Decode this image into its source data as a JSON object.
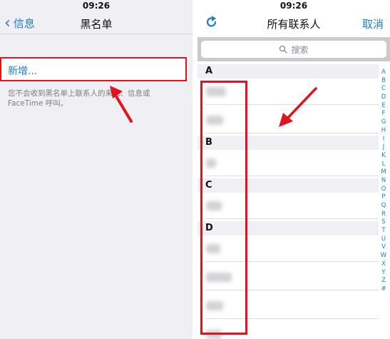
{
  "left": {
    "status_time": "09:26",
    "back_label": "信息",
    "title": "黑名单",
    "add_label": "新增...",
    "hint": "您不会收到黑名单上联系人的来电、信息或 FaceTime 呼叫。"
  },
  "right": {
    "status_time": "09:26",
    "title": "所有联系人",
    "cancel_label": "取消",
    "search_placeholder": "搜索",
    "sections": [
      {
        "letter": "A",
        "rows": 2
      },
      {
        "letter": "B",
        "rows": 1
      },
      {
        "letter": "C",
        "rows": 1
      },
      {
        "letter": "D",
        "rows": 4
      }
    ],
    "index_letters": [
      "A",
      "B",
      "C",
      "D",
      "E",
      "F",
      "G",
      "H",
      "I",
      "J",
      "K",
      "L",
      "M",
      "N",
      "O",
      "P",
      "Q",
      "R",
      "S",
      "T",
      "U",
      "V",
      "W",
      "X",
      "Y",
      "Z",
      "#"
    ]
  },
  "colors": {
    "accent": "#1e7ad6",
    "annotation": "#e0141e"
  }
}
